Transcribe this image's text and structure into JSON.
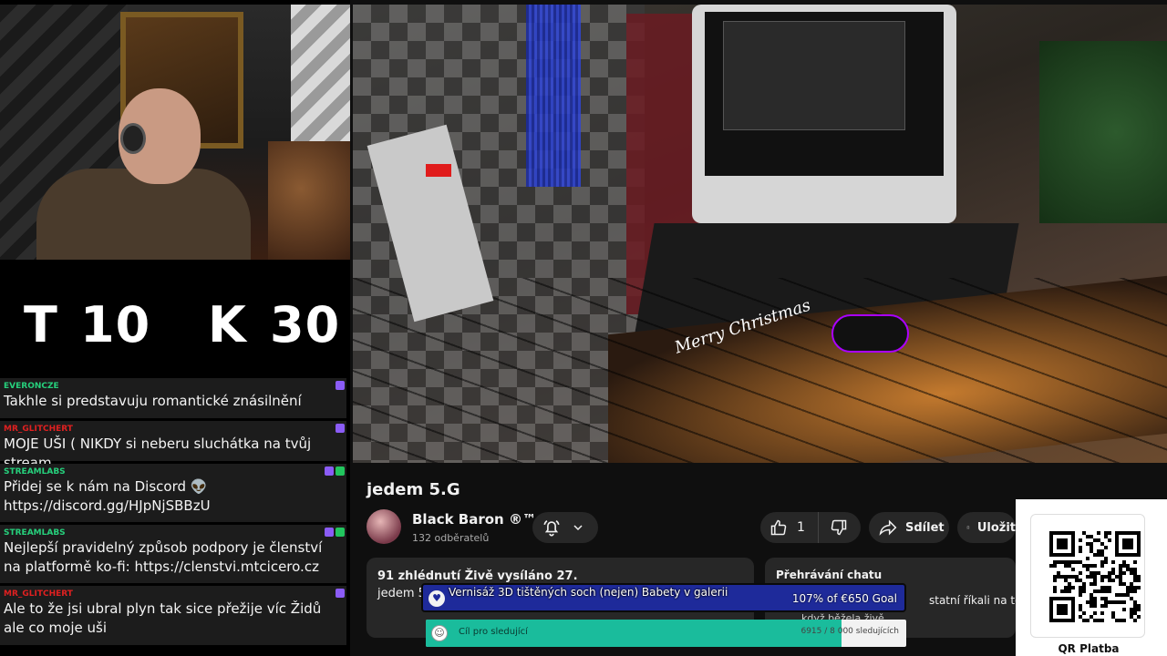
{
  "counter": {
    "t_label": "T",
    "t_value": "10",
    "k_label": "K",
    "k_value": "30"
  },
  "chat_messages": [
    {
      "user": "EVERONCZE",
      "user_color": "#26d07c",
      "text": "Takhle si predstavuju romantické znásilnění"
    },
    {
      "user": "MR_GLITCHERT",
      "user_color": "#e02020",
      "text": "MOJE UŠI ( NIKDY si neberu sluchátka na tvůj stream"
    },
    {
      "user": "STREAMLABS",
      "user_color": "#26d07c",
      "text": "Přidej se k nám na Discord 👽 https://discord.gg/HJpNjSBBzU"
    },
    {
      "user": "STREAMLABS",
      "user_color": "#26d07c",
      "text": "Nejlepší pravidelný způsob podpory je členství na platformě ko-fi: https://clenstvi.mtcicero.cz"
    },
    {
      "user": "MR_GLITCHERT",
      "user_color": "#e02020",
      "text": "Ale to že jsi ubral plyn tak sice přežije víc Židů ale co moje uši"
    }
  ],
  "video": {
    "overlay_text": "Merry Christmas"
  },
  "video_title": "jedem 5.G",
  "channel": {
    "name": "Black Baron ®™",
    "subscribers": "132 odběratelů"
  },
  "actions": {
    "like_count": "1",
    "share_label": "Sdílet",
    "save_label": "Uložit"
  },
  "description": {
    "stats": "91 zhlédnutí  Živě vysíláno 27.",
    "text": "jedem 5"
  },
  "chat_replay": {
    "title": "Přehrávání chatu",
    "line1": "statní říkali na toto vi",
    "line2": "když běžela živě"
  },
  "goal": {
    "text": "Vernisáž 3D tištěných soch (nejen) Babety v galerii",
    "value": "107% of €650 Goal",
    "percent": 107
  },
  "follower_goal": {
    "label": "Cíl pro sledující",
    "value": "6915 / 8 000 sledujících",
    "current": 6915,
    "target": 8000
  },
  "qr": {
    "label": "QR Platba"
  },
  "colors": {
    "accent": "#1abc9c",
    "goal_bg": "#1e2a9a",
    "yt_pill": "#272727"
  }
}
